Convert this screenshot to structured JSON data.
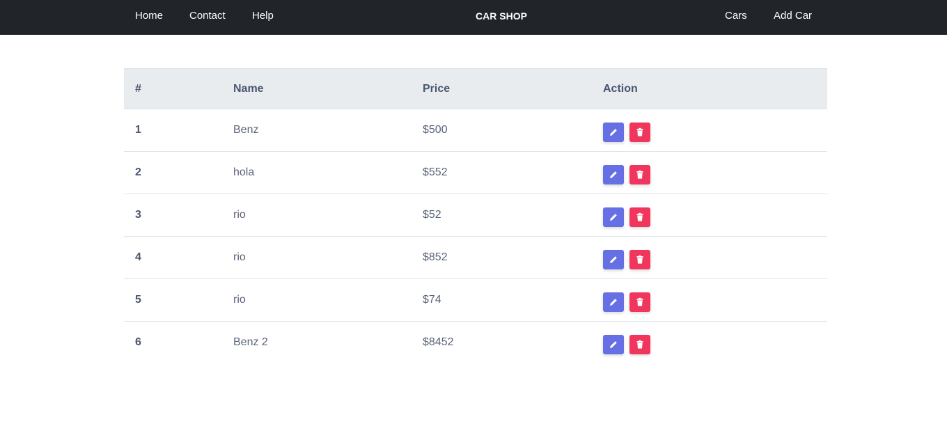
{
  "navbar": {
    "left_links": [
      "Home",
      "Contact",
      "Help"
    ],
    "brand": "CAR SHOP",
    "right_links": [
      "Cars",
      "Add Car"
    ]
  },
  "table": {
    "columns": [
      "#",
      "Name",
      "Price",
      "Action"
    ],
    "rows": [
      {
        "num": "1",
        "name": "Benz",
        "price": "$500"
      },
      {
        "num": "2",
        "name": "hola",
        "price": "$552"
      },
      {
        "num": "3",
        "name": "rio",
        "price": "$52"
      },
      {
        "num": "4",
        "name": "rio",
        "price": "$852"
      },
      {
        "num": "5",
        "name": "rio",
        "price": "$74"
      },
      {
        "num": "6",
        "name": "Benz 2",
        "price": "$8452"
      }
    ]
  },
  "icons": {
    "edit": "pencil-icon",
    "delete": "trash-icon"
  },
  "colors": {
    "navbar_bg": "#212529",
    "edit_button": "#6670e4",
    "delete_button": "#f0365c",
    "header_bg": "#e9ecef"
  }
}
